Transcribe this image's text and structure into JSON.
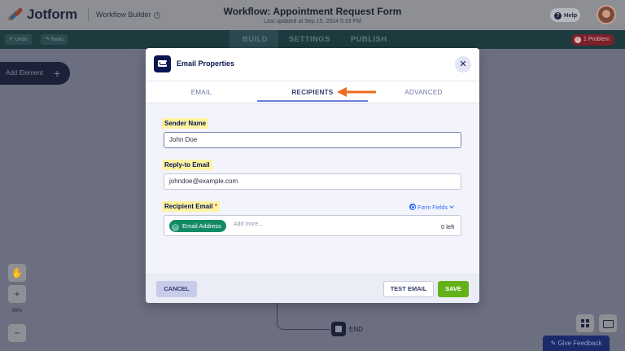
{
  "app": {
    "logo_text": "Jotform",
    "breadcrumb": "Workflow Builder",
    "title": "Workflow: Appointment Request Form",
    "subtitle": "Last updated at Sep 15, 2024 5:33 PM",
    "help_label": "Help"
  },
  "toolbar": {
    "undo_label": "Undo",
    "redo_label": "Redo",
    "tabs": [
      {
        "label": "BUILD"
      },
      {
        "label": "SETTINGS"
      },
      {
        "label": "PUBLISH"
      }
    ],
    "problem_count": "1",
    "problem_label": "1 Problem"
  },
  "canvas": {
    "add_element_label": "Add Element",
    "zoom_level": "89%",
    "end_label": "END",
    "feedback_label": "Give Feedback"
  },
  "modal": {
    "title": "Email Properties",
    "tabs": [
      {
        "label": "EMAIL",
        "active": false
      },
      {
        "label": "RECIPIENTS",
        "active": true
      },
      {
        "label": "ADVANCED",
        "active": false
      }
    ],
    "sender_name_label": "Sender Name",
    "sender_name_value": "John Doe",
    "reply_to_label": "Reply-to Email",
    "reply_to_value": "johndoe@example.com",
    "recipient_label": "Recipient Email",
    "required_mark": "*",
    "form_fields_label": "Form Fields",
    "recipient_chip": "Email Address",
    "add_more_placeholder": "Add more...",
    "left_count": "0 left",
    "cancel_label": "CANCEL",
    "test_email_label": "TEST EMAIL",
    "save_label": "SAVE"
  },
  "colors": {
    "brand_navy": "#0a1551",
    "save_green": "#64b21a",
    "chip_green": "#138a66",
    "highlight_yellow": "#fdf3a1",
    "arrow_orange": "#ee6a1e",
    "link_blue": "#2e69ff"
  }
}
